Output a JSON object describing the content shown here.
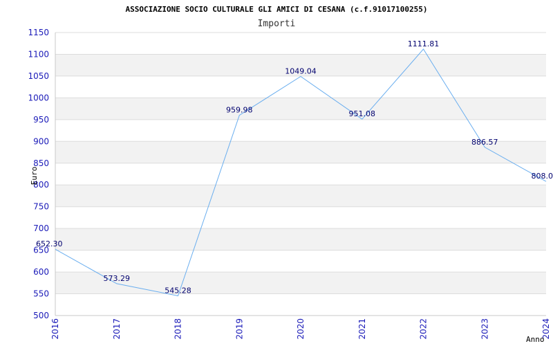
{
  "chart_data": {
    "type": "line",
    "title": "ASSOCIAZIONE SOCIO CULTURALE GLI AMICI DI CESANA (c.f.91017100255)",
    "subtitle": "Importi",
    "xlabel": "Anno",
    "ylabel": "Euro",
    "categories": [
      "2016",
      "2017",
      "2018",
      "2019",
      "2020",
      "2021",
      "2022",
      "2023",
      "2024"
    ],
    "values": [
      652.3,
      573.29,
      545.28,
      959.98,
      1049.04,
      951.08,
      1111.81,
      886.57,
      808.0
    ],
    "data_labels": [
      "652.30",
      "573.29",
      "545.28",
      "959.98",
      "1049.04",
      "951.08",
      "1111.81",
      "886.57",
      "808.0"
    ],
    "ylim": [
      500,
      1150
    ],
    "yticks": [
      500,
      550,
      600,
      650,
      700,
      750,
      800,
      850,
      900,
      950,
      1000,
      1050,
      1100,
      1150
    ],
    "grid": true,
    "band_color": "#f2f2f2",
    "line_color": "#6aaeef",
    "tick_color": "#1a1ab8",
    "label_color": "#00006e"
  }
}
